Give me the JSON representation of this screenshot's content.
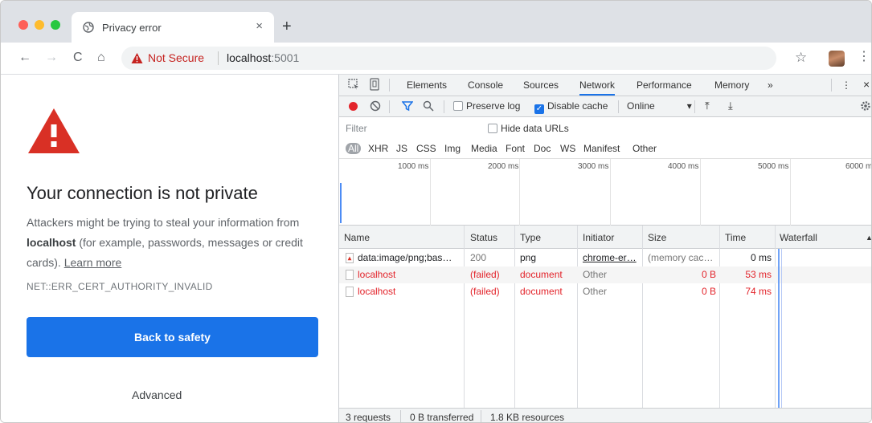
{
  "browser": {
    "tab_title": "Privacy error",
    "tab_close": "×",
    "new_tab": "+",
    "nav_back": "←",
    "nav_forward": "→",
    "reload": "C",
    "home": "⌂",
    "security_label": "Not Secure",
    "url_host": "localhost",
    "url_port": ":5001",
    "bookmark_star": "☆",
    "menu": "⋮"
  },
  "error_page": {
    "title": "Your connection is not private",
    "body_prefix": "Attackers might be trying to steal your information from ",
    "body_host": "localhost",
    "body_suffix": " (for example, passwords, messages or credit cards). ",
    "learn_more": "Learn more",
    "error_code": "NET::ERR_CERT_AUTHORITY_INVALID",
    "back_button": "Back to safety",
    "advanced": "Advanced"
  },
  "devtools": {
    "tabs": [
      "Elements",
      "Console",
      "Sources",
      "Network",
      "Performance",
      "Memory",
      "»"
    ],
    "active_tab": "Network",
    "more_menu": "⋮",
    "close": "×",
    "controls": {
      "preserve_log": "Preserve log",
      "disable_cache": "Disable cache",
      "disable_cache_checked": true,
      "throttling": "Online",
      "throttling_arrow": "▾",
      "upload": "⤒",
      "download": "⤓"
    },
    "filter_placeholder": "Filter",
    "hide_data_urls": "Hide data URLs",
    "type_filters": [
      "All",
      "XHR",
      "JS",
      "CSS",
      "Img",
      "Media",
      "Font",
      "Doc",
      "WS",
      "Manifest",
      "Other"
    ],
    "overview_ticks": [
      "1000 ms",
      "2000 ms",
      "3000 ms",
      "4000 ms",
      "5000 ms",
      "6000 m"
    ],
    "columns": [
      "Name",
      "Status",
      "Type",
      "Initiator",
      "Size",
      "Time",
      "Waterfall"
    ],
    "rows": [
      {
        "name": "data:image/png;bas…",
        "status": "200",
        "type": "png",
        "initiator": "chrome-er…",
        "size": "(memory cac…",
        "time": "0 ms",
        "failed": false
      },
      {
        "name": "localhost",
        "status": "(failed)",
        "type": "document",
        "initiator": "Other",
        "size": "0 B",
        "time": "53 ms",
        "failed": true
      },
      {
        "name": "localhost",
        "status": "(failed)",
        "type": "document",
        "initiator": "Other",
        "size": "0 B",
        "time": "74 ms",
        "failed": true
      }
    ],
    "status_bar": {
      "requests": "3 requests",
      "transferred": "0 B transferred",
      "resources": "1.8 KB resources"
    },
    "colors": {
      "accent": "#1a73e8",
      "error": "#e3242b"
    }
  }
}
